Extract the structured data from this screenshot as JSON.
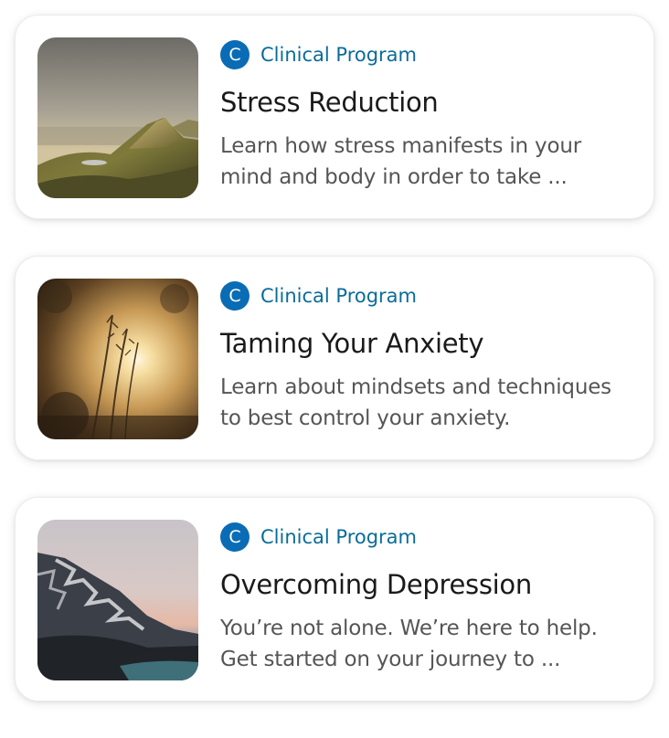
{
  "programs": [
    {
      "badge_letter": "C",
      "badge_label": "Clinical Program",
      "title": "Stress Reduction",
      "description_lines": [
        "Learn how stress manifests in your",
        "mind and body in order to take ..."
      ],
      "image": "mountain-valley-sunset-photo"
    },
    {
      "badge_letter": "C",
      "badge_label": "Clinical Program",
      "title": "Taming Your Anxiety",
      "description_lines": [
        "Learn about mindsets and techniques",
        "to best control your anxiety."
      ],
      "image": "sun-through-grass-photo"
    },
    {
      "badge_letter": "C",
      "badge_label": "Clinical Program",
      "title": "Overcoming Depression",
      "description_lines": [
        "You’re not alone. We’re here to help.",
        "Get started on your journey to ..."
      ],
      "image": "snowy-mountain-lake-photo"
    }
  ],
  "colors": {
    "badge_bg": "#0a6cb5",
    "badge_text": "#0a6c99",
    "title": "#1a1a1a",
    "description": "#555555"
  }
}
